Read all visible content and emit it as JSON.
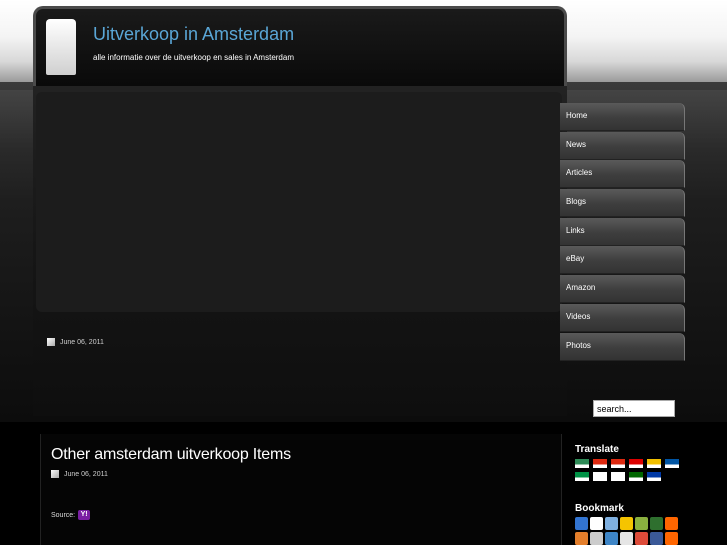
{
  "site": {
    "title": "Uitverkoop in Amsterdam",
    "description": "alle informatie over de uitverkoop en sales in Amsterdam"
  },
  "nav": {
    "items": [
      {
        "label": "Home"
      },
      {
        "label": "News"
      },
      {
        "label": "Articles"
      },
      {
        "label": "Blogs"
      },
      {
        "label": "Links"
      },
      {
        "label": "eBay"
      },
      {
        "label": "Amazon"
      },
      {
        "label": "Videos"
      },
      {
        "label": "Photos"
      }
    ]
  },
  "featured": {
    "date": "June 06, 2011"
  },
  "search": {
    "value": "search..."
  },
  "post": {
    "title": "Other amsterdam uitverkoop Items",
    "date": "June 06, 2011",
    "source_label": "Source:",
    "source_icon": "yahoo-icon"
  },
  "sidebar": {
    "translate_heading": "Translate",
    "bookmark_heading": "Bookmark",
    "flags": [
      {
        "name": "arabic-flag",
        "color": "#2e8b57"
      },
      {
        "name": "chinese-flag",
        "color": "#de2910"
      },
      {
        "name": "chinese-traditional-flag",
        "color": "#de2910"
      },
      {
        "name": "german-flag",
        "color": "#dd0000"
      },
      {
        "name": "spanish-flag",
        "color": "#f1bf00"
      },
      {
        "name": "french-flag",
        "color": "#0055a4"
      },
      {
        "name": "italian-flag",
        "color": "#009246"
      },
      {
        "name": "japanese-flag",
        "color": "#ffffff"
      },
      {
        "name": "korean-flag",
        "color": "#ffffff"
      },
      {
        "name": "portuguese-flag",
        "color": "#006600"
      },
      {
        "name": "russian-flag",
        "color": "#0039a6"
      }
    ],
    "bookmarks": [
      {
        "name": "delicious-icon",
        "color": "#3274d1"
      },
      {
        "name": "digg-icon",
        "color": "#ffffff"
      },
      {
        "name": "blogmarks-icon",
        "color": "#7fb0e0"
      },
      {
        "name": "wikio-icon",
        "color": "#f5c400"
      },
      {
        "name": "stumble-icon",
        "color": "#8ab03f"
      },
      {
        "name": "newsvine-icon",
        "color": "#2e6f2e"
      },
      {
        "name": "reddit-icon",
        "color": "#ff6600"
      },
      {
        "name": "technorati-icon",
        "color": "#e37e2b"
      },
      {
        "name": "furl-icon",
        "color": "#cccccc"
      },
      {
        "name": "blinklist-icon",
        "color": "#3d85c6"
      },
      {
        "name": "spurl-icon",
        "color": "#e5e5e5"
      },
      {
        "name": "google-icon",
        "color": "#dd4b39"
      },
      {
        "name": "facebook-icon",
        "color": "#3b5998"
      },
      {
        "name": "magnolia-icon",
        "color": "#ff6600"
      }
    ]
  }
}
